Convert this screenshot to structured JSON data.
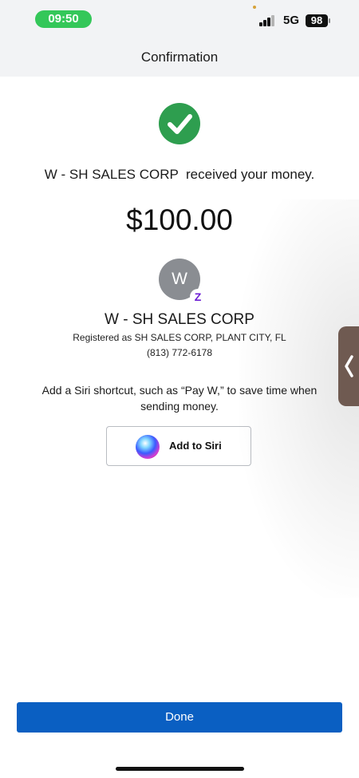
{
  "status_bar": {
    "time": "09:50",
    "network": "5G",
    "battery": "98",
    "icons": [
      "signal-icon",
      "battery-icon"
    ]
  },
  "header": {
    "title": "Confirmation"
  },
  "confirmation": {
    "icon": "checkmark-circle-icon",
    "message": "W - SH SALES CORP  received your money.",
    "amount": "$100.00"
  },
  "recipient": {
    "avatar_initial": "W",
    "badge": "zelle-logo-icon",
    "name": "W - SH SALES CORP",
    "registered_as": "Registered as SH SALES CORP, PLANT CITY, FL",
    "phone": "(813) 772-6178"
  },
  "siri": {
    "prompt": "Add a Siri shortcut, such as “Pay W,” to save time when sending money.",
    "button_label": "Add to Siri",
    "icon": "siri-orb-icon"
  },
  "side_tab": {
    "icon": "chevron-left-icon"
  },
  "footer": {
    "done_label": "Done"
  },
  "colors": {
    "accent": "#0a5fc2",
    "success": "#2e9e4f",
    "time_pill": "#34c759",
    "zelle": "#6d1ed4"
  }
}
